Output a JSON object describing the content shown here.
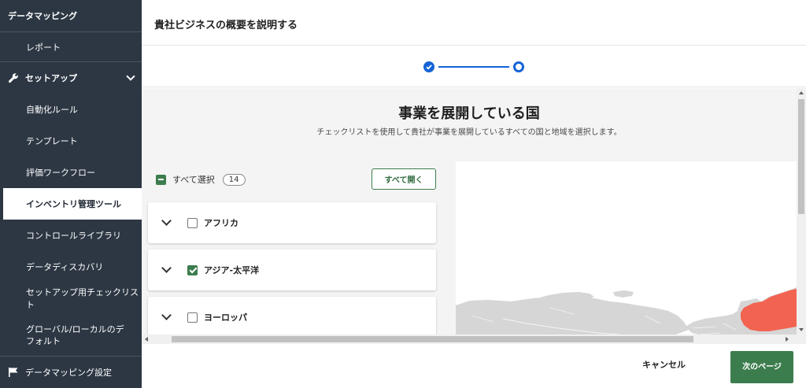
{
  "sidebar": {
    "top_title": "データマッピング",
    "report": "レポート",
    "setup": "セットアップ",
    "items": [
      {
        "label": "自動化ルール"
      },
      {
        "label": "テンプレート"
      },
      {
        "label": "評価ワークフロー"
      },
      {
        "label": "インベントリ管理ツール",
        "active": true
      },
      {
        "label": "コントロールライブラリ"
      },
      {
        "label": "データディスカバリ"
      },
      {
        "label": "セットアップ用チェックリスト"
      },
      {
        "label": "グローバル/ローカルのデフォルト"
      }
    ],
    "settings": "データマッピング設定"
  },
  "header": {
    "title": "貴社ビジネスの概要を説明する"
  },
  "stepper": {
    "total_steps": 2,
    "current_step": 2
  },
  "main": {
    "heading": "事業を展開している国",
    "subheading": "チェックリストを使用して貴社が事業を展開しているすべての国と地域を選択します。",
    "select_all_label": "すべて選択",
    "select_all_count": "14",
    "expand_all_label": "すべて開く",
    "regions": [
      {
        "label": "アフリカ",
        "checked": false
      },
      {
        "label": "アジア-太平洋",
        "checked": true
      },
      {
        "label": "ヨーロッパ",
        "checked": false
      }
    ]
  },
  "colors": {
    "sidebar_bg": "#2d3744",
    "accent_green": "#3c7d4e",
    "step_blue": "#1463d6",
    "map_land": "#d6d6d6",
    "map_selected": "#f26451"
  },
  "footer": {
    "cancel_label": "キャンセル",
    "next_label": "次のページ"
  }
}
